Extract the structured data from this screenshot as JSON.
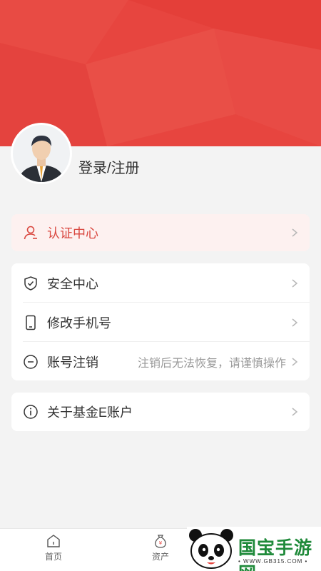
{
  "profile": {
    "login_label": "登录/注册"
  },
  "certification": {
    "label": "认证中心",
    "icon": "user-outline-icon"
  },
  "security_menu": [
    {
      "label": "安全中心",
      "hint": "",
      "icon": "shield-check-icon"
    },
    {
      "label": "修改手机号",
      "hint": "",
      "icon": "phone-icon"
    },
    {
      "label": "账号注销",
      "hint": "注销后无法恢复，请谨慎操作",
      "icon": "minus-circle-icon"
    }
  ],
  "about": {
    "label": "关于基金E账户",
    "icon": "info-circle-icon"
  },
  "tabbar": {
    "home": "首页",
    "assets": "资产"
  },
  "watermark": {
    "name": "国宝手游网",
    "url": "• WWW.GB315.COM •"
  },
  "colors": {
    "brand_red": "#e7453f",
    "cert_bg": "#fdf1f0",
    "watermark_green": "#1f8a3a"
  }
}
